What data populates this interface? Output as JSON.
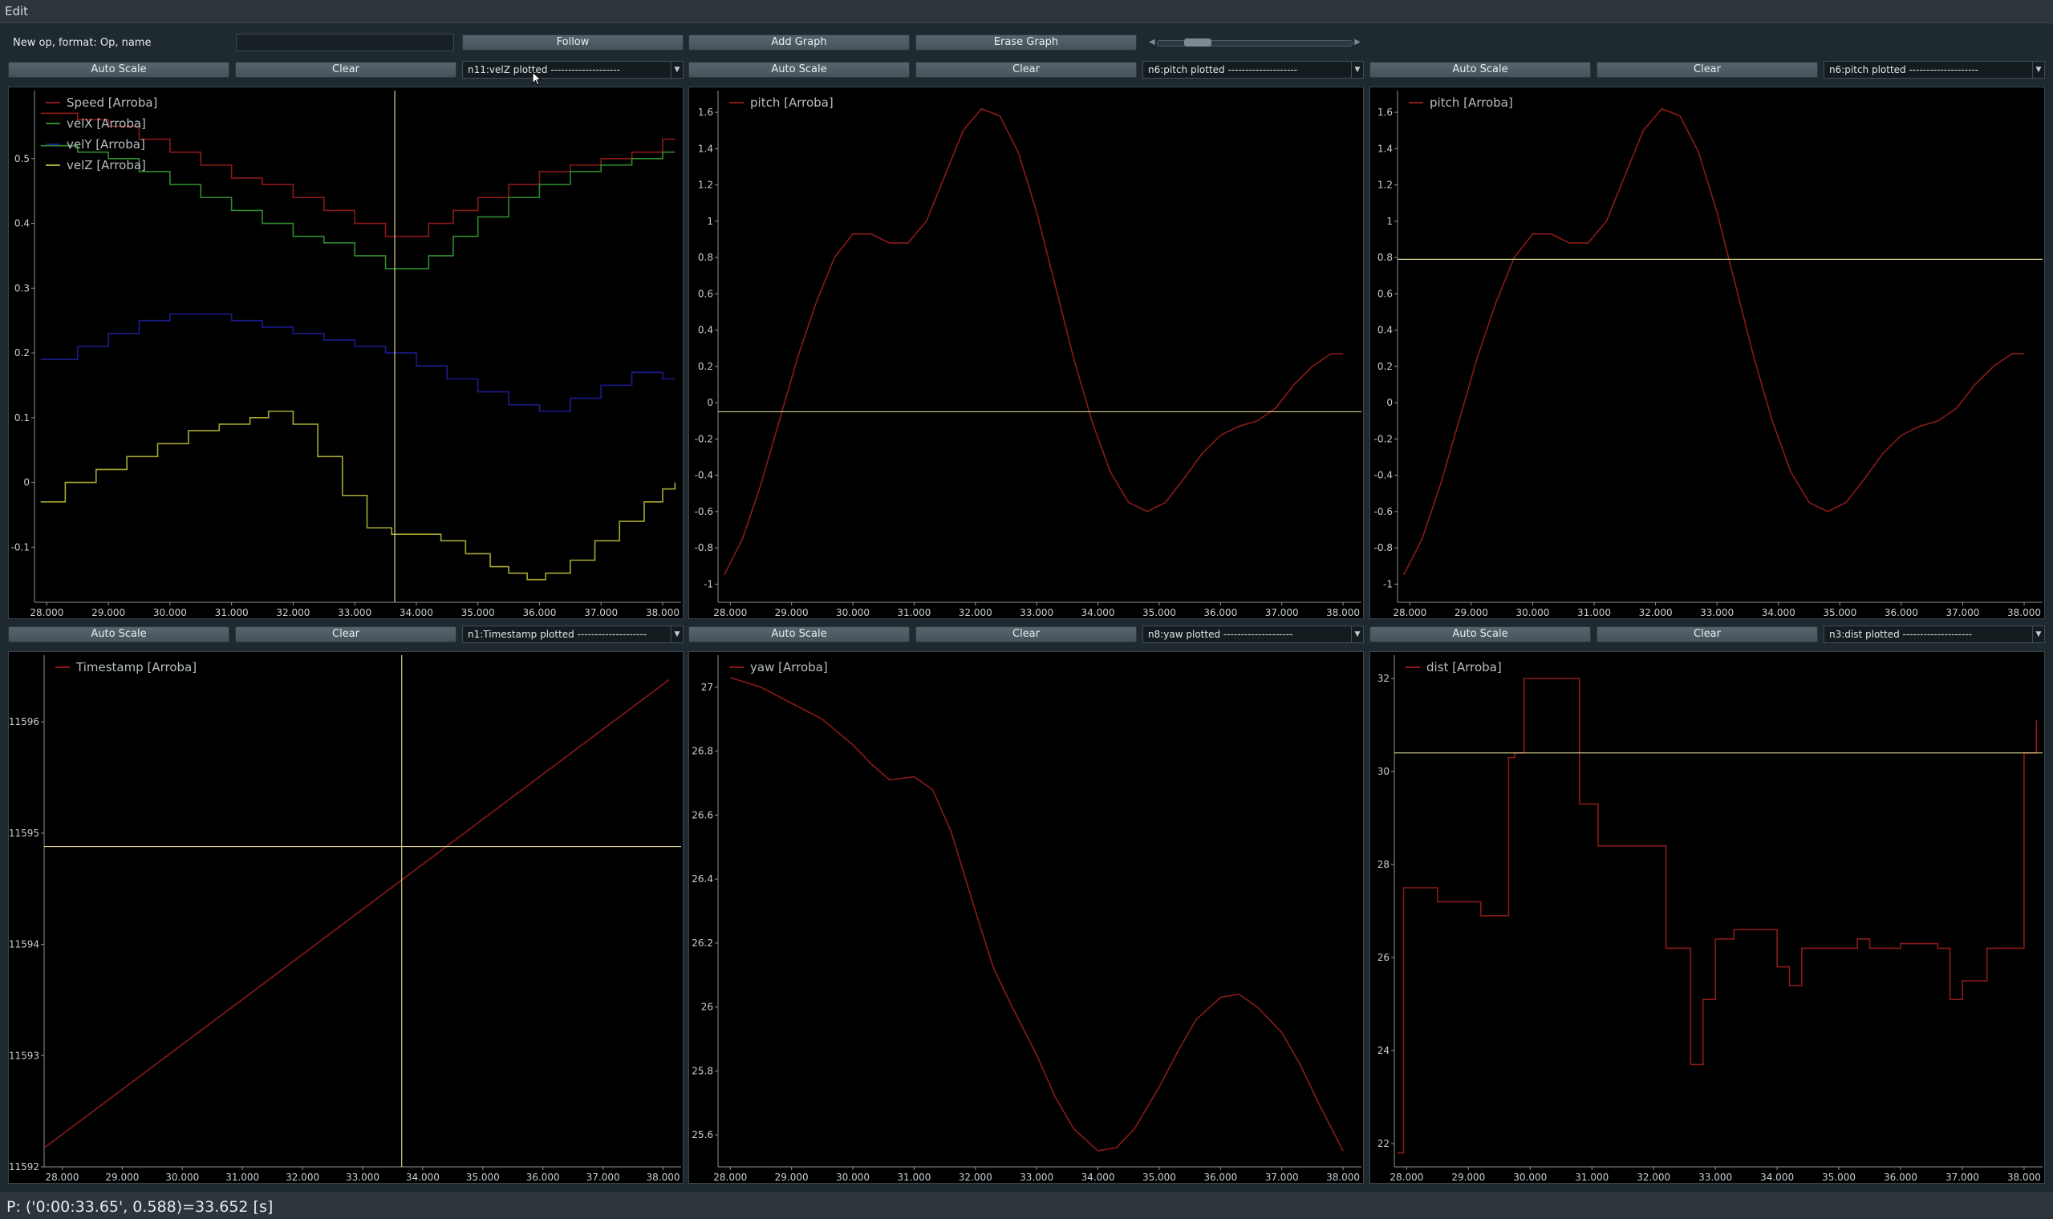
{
  "menubar": {
    "edit": "Edit"
  },
  "toolbar": {
    "new_op_label": "New op, format: Op, name",
    "new_op_value": "",
    "follow": "Follow",
    "add_graph": "Add Graph",
    "erase_graph": "Erase Graph"
  },
  "panels": [
    {
      "autoscale": "Auto Scale",
      "clear": "Clear",
      "selector": "n11:velZ plotted --------------------",
      "chart_data": {
        "type": "line",
        "xlim": [
          27.8,
          38.3
        ],
        "ylim": [
          -0.185,
          0.605
        ],
        "xticks": [
          "28.000",
          "29.000",
          "30.000",
          "31.000",
          "32.000",
          "33.000",
          "34.000",
          "35.000",
          "36.000",
          "37.000",
          "38.000"
        ],
        "yticks": [
          {
            "v": 0.5,
            "t": "0.5"
          },
          {
            "v": 0.4,
            "t": "0.4"
          },
          {
            "v": 0.3,
            "t": "0.3"
          },
          {
            "v": 0.2,
            "t": "0.2"
          },
          {
            "v": 0.1,
            "t": "0.1"
          },
          {
            "v": 0,
            "t": "0"
          },
          {
            "v": -0.1,
            "t": "-0.1"
          }
        ],
        "step": true,
        "cursor": {
          "x": 33.65
        },
        "series": [
          {
            "name": "Speed [Arroba]",
            "color": "#8b1a1a",
            "x": [
              27.9,
              28.5,
              29.0,
              29.5,
              30.0,
              30.5,
              31.0,
              31.5,
              32.0,
              32.5,
              33.0,
              33.5,
              33.8,
              34.2,
              34.6,
              35.0,
              35.5,
              36.0,
              36.5,
              37.0,
              37.5,
              38.0,
              38.2
            ],
            "y": [
              0.57,
              0.56,
              0.55,
              0.53,
              0.51,
              0.49,
              0.47,
              0.46,
              0.44,
              0.42,
              0.4,
              0.38,
              0.38,
              0.4,
              0.42,
              0.44,
              0.46,
              0.48,
              0.49,
              0.5,
              0.51,
              0.53,
              0.53
            ]
          },
          {
            "name": "velX [Arroba]",
            "color": "#2e8b2e",
            "x": [
              27.9,
              28.5,
              29.0,
              29.5,
              30.0,
              30.5,
              31.0,
              31.5,
              32.0,
              32.5,
              33.0,
              33.5,
              33.8,
              34.2,
              34.6,
              35.0,
              35.5,
              36.0,
              36.5,
              37.0,
              37.5,
              38.0,
              38.2
            ],
            "y": [
              0.52,
              0.51,
              0.5,
              0.48,
              0.46,
              0.44,
              0.42,
              0.4,
              0.38,
              0.37,
              0.35,
              0.33,
              0.33,
              0.35,
              0.38,
              0.41,
              0.44,
              0.46,
              0.48,
              0.49,
              0.5,
              0.51,
              0.51
            ]
          },
          {
            "name": "velY [Arroba]",
            "color": "#1c1c8f",
            "x": [
              27.9,
              28.5,
              29.0,
              29.5,
              30.0,
              30.5,
              31.0,
              31.5,
              32.0,
              32.5,
              33.0,
              33.5,
              34.0,
              34.5,
              35.0,
              35.5,
              36.0,
              36.5,
              37.0,
              37.5,
              38.0,
              38.2
            ],
            "y": [
              0.19,
              0.21,
              0.23,
              0.25,
              0.26,
              0.26,
              0.25,
              0.24,
              0.23,
              0.22,
              0.21,
              0.2,
              0.18,
              0.16,
              0.14,
              0.12,
              0.11,
              0.13,
              0.15,
              0.17,
              0.16,
              0.16
            ]
          },
          {
            "name": "velZ [Arroba]",
            "color": "#a8a832",
            "x": [
              27.9,
              28.3,
              28.8,
              29.3,
              29.8,
              30.3,
              30.8,
              31.3,
              31.6,
              32.0,
              32.4,
              32.8,
              33.2,
              33.6,
              34.0,
              34.4,
              34.8,
              35.2,
              35.5,
              35.8,
              36.1,
              36.5,
              36.9,
              37.3,
              37.7,
              38.0,
              38.2
            ],
            "y": [
              -0.03,
              0.0,
              0.02,
              0.04,
              0.06,
              0.08,
              0.09,
              0.1,
              0.11,
              0.09,
              0.04,
              -0.02,
              -0.07,
              -0.08,
              -0.08,
              -0.09,
              -0.11,
              -0.13,
              -0.14,
              -0.15,
              -0.14,
              -0.12,
              -0.09,
              -0.06,
              -0.03,
              -0.01,
              0.0
            ]
          }
        ]
      }
    },
    {
      "autoscale": "Auto Scale",
      "clear": "Clear",
      "selector": "n6:pitch plotted --------------------",
      "chart_data": {
        "type": "line",
        "xlim": [
          27.8,
          38.3
        ],
        "ylim": [
          -1.1,
          1.72
        ],
        "xticks": [
          "28.000",
          "29.000",
          "30.000",
          "31.000",
          "32.000",
          "33.000",
          "34.000",
          "35.000",
          "36.000",
          "37.000",
          "38.000"
        ],
        "yticks": [
          {
            "v": 1.6,
            "t": "1.6"
          },
          {
            "v": 1.4,
            "t": "1.4"
          },
          {
            "v": 1.2,
            "t": "1.2"
          },
          {
            "v": 1,
            "t": "1"
          },
          {
            "v": 0.8,
            "t": "0.8"
          },
          {
            "v": 0.6,
            "t": "0.6"
          },
          {
            "v": 0.4,
            "t": "0.4"
          },
          {
            "v": 0.2,
            "t": "0.2"
          },
          {
            "v": 0,
            "t": "0"
          },
          {
            "v": -0.2,
            "t": "-0.2"
          },
          {
            "v": -0.4,
            "t": "-0.4"
          },
          {
            "v": -0.6,
            "t": "-0.6"
          },
          {
            "v": -0.8,
            "t": "-0.8"
          },
          {
            "v": -1,
            "t": "-1"
          }
        ],
        "hline": -0.05,
        "series": [
          {
            "name": "pitch [Arroba]",
            "color": "#8b1a1a",
            "x": [
              27.9,
              28.2,
              28.5,
              28.8,
              29.1,
              29.4,
              29.7,
              30.0,
              30.3,
              30.6,
              30.9,
              31.2,
              31.5,
              31.8,
              32.1,
              32.4,
              32.7,
              33.0,
              33.3,
              33.6,
              33.9,
              34.2,
              34.5,
              34.8,
              35.1,
              35.4,
              35.7,
              36.0,
              36.3,
              36.6,
              36.9,
              37.2,
              37.5,
              37.8,
              38.0
            ],
            "y": [
              -0.95,
              -0.75,
              -0.45,
              -0.1,
              0.25,
              0.55,
              0.8,
              0.93,
              0.93,
              0.88,
              0.88,
              1.0,
              1.25,
              1.5,
              1.62,
              1.58,
              1.38,
              1.05,
              0.65,
              0.25,
              -0.1,
              -0.38,
              -0.55,
              -0.6,
              -0.55,
              -0.42,
              -0.28,
              -0.18,
              -0.13,
              -0.1,
              -0.03,
              0.1,
              0.2,
              0.27,
              0.27
            ]
          }
        ]
      }
    },
    {
      "autoscale": "Auto Scale",
      "clear": "Clear",
      "selector": "n6:pitch plotted --------------------",
      "chart_data": {
        "type": "line",
        "xlim": [
          27.8,
          38.3
        ],
        "ylim": [
          -1.1,
          1.72
        ],
        "xticks": [
          "28.000",
          "29.000",
          "30.000",
          "31.000",
          "32.000",
          "33.000",
          "34.000",
          "35.000",
          "36.000",
          "37.000",
          "38.000"
        ],
        "yticks": [
          {
            "v": 1.6,
            "t": "1.6"
          },
          {
            "v": 1.4,
            "t": "1.4"
          },
          {
            "v": 1.2,
            "t": "1.2"
          },
          {
            "v": 1,
            "t": "1"
          },
          {
            "v": 0.8,
            "t": "0.8"
          },
          {
            "v": 0.6,
            "t": "0.6"
          },
          {
            "v": 0.4,
            "t": "0.4"
          },
          {
            "v": 0.2,
            "t": "0.2"
          },
          {
            "v": 0,
            "t": "0"
          },
          {
            "v": -0.2,
            "t": "-0.2"
          },
          {
            "v": -0.4,
            "t": "-0.4"
          },
          {
            "v": -0.6,
            "t": "-0.6"
          },
          {
            "v": -0.8,
            "t": "-0.8"
          },
          {
            "v": -1,
            "t": "-1"
          }
        ],
        "hline": 0.79,
        "series": [
          {
            "name": "pitch [Arroba]",
            "color": "#8b1a1a",
            "x": [
              27.9,
              28.2,
              28.5,
              28.8,
              29.1,
              29.4,
              29.7,
              30.0,
              30.3,
              30.6,
              30.9,
              31.2,
              31.5,
              31.8,
              32.1,
              32.4,
              32.7,
              33.0,
              33.3,
              33.6,
              33.9,
              34.2,
              34.5,
              34.8,
              35.1,
              35.4,
              35.7,
              36.0,
              36.3,
              36.6,
              36.9,
              37.2,
              37.5,
              37.8,
              38.0
            ],
            "y": [
              -0.95,
              -0.75,
              -0.45,
              -0.1,
              0.25,
              0.55,
              0.8,
              0.93,
              0.93,
              0.88,
              0.88,
              1.0,
              1.25,
              1.5,
              1.62,
              1.58,
              1.38,
              1.05,
              0.65,
              0.25,
              -0.1,
              -0.38,
              -0.55,
              -0.6,
              -0.55,
              -0.42,
              -0.28,
              -0.18,
              -0.13,
              -0.1,
              -0.03,
              0.1,
              0.2,
              0.27,
              0.27
            ]
          }
        ]
      }
    },
    {
      "autoscale": "Auto Scale",
      "clear": "Clear",
      "selector": "n1:Timestamp plotted --------------------",
      "chart_data": {
        "type": "line",
        "xlim": [
          27.7,
          38.3
        ],
        "ylim": [
          11592.0,
          11596.6
        ],
        "xticks": [
          "28.000",
          "29.000",
          "30.000",
          "31.000",
          "32.000",
          "33.000",
          "34.000",
          "35.000",
          "36.000",
          "37.000",
          "38.000"
        ],
        "yticks": [
          {
            "v": 11596,
            "t": "11596"
          },
          {
            "v": 11595,
            "t": "11595"
          },
          {
            "v": 11594,
            "t": "11594"
          },
          {
            "v": 11593,
            "t": "11593"
          },
          {
            "v": 11592,
            "t": "11592"
          }
        ],
        "hline": 11594.88,
        "cursor": {
          "x": 33.65
        },
        "series": [
          {
            "name": "Timestamp [Arroba]",
            "color": "#8b1a1a",
            "x": [
              27.7,
              38.1
            ],
            "y": [
              11592.17,
              11596.38
            ]
          }
        ]
      }
    },
    {
      "autoscale": "Auto Scale",
      "clear": "Clear",
      "selector": "n8:yaw plotted --------------------",
      "chart_data": {
        "type": "line",
        "xlim": [
          27.8,
          38.3
        ],
        "ylim": [
          25.5,
          27.1
        ],
        "xticks": [
          "28.000",
          "29.000",
          "30.000",
          "31.000",
          "32.000",
          "33.000",
          "34.000",
          "35.000",
          "36.000",
          "37.000",
          "38.000"
        ],
        "yticks": [
          {
            "v": 27,
            "t": "27"
          },
          {
            "v": 26.8,
            "t": "26.8"
          },
          {
            "v": 26.6,
            "t": "26.6"
          },
          {
            "v": 26.4,
            "t": "26.4"
          },
          {
            "v": 26.2,
            "t": "26.2"
          },
          {
            "v": 26,
            "t": "26"
          },
          {
            "v": 25.8,
            "t": "25.8"
          },
          {
            "v": 25.6,
            "t": "25.6"
          }
        ],
        "series": [
          {
            "name": "yaw [Arroba]",
            "color": "#8b1a1a",
            "x": [
              28.0,
              28.5,
              29.0,
              29.5,
              30.0,
              30.3,
              30.6,
              31.0,
              31.3,
              31.6,
              32.0,
              32.3,
              32.6,
              33.0,
              33.3,
              33.6,
              34.0,
              34.3,
              34.6,
              35.0,
              35.3,
              35.6,
              36.0,
              36.3,
              36.6,
              37.0,
              37.3,
              37.6,
              38.0
            ],
            "y": [
              27.03,
              27.0,
              26.95,
              26.9,
              26.82,
              26.76,
              26.71,
              26.72,
              26.68,
              26.55,
              26.3,
              26.12,
              26.0,
              25.85,
              25.72,
              25.62,
              25.55,
              25.56,
              25.62,
              25.75,
              25.86,
              25.96,
              26.03,
              26.04,
              26.0,
              25.92,
              25.82,
              25.7,
              25.55
            ]
          }
        ]
      }
    },
    {
      "autoscale": "Auto Scale",
      "clear": "Clear",
      "selector": "n3:dist plotted --------------------",
      "chart_data": {
        "type": "line",
        "xlim": [
          27.8,
          38.3
        ],
        "ylim": [
          21.5,
          32.5
        ],
        "xticks": [
          "28.000",
          "29.000",
          "30.000",
          "31.000",
          "32.000",
          "33.000",
          "34.000",
          "35.000",
          "36.000",
          "37.000",
          "38.000"
        ],
        "yticks": [
          {
            "v": 32,
            "t": "32"
          },
          {
            "v": 30,
            "t": "30"
          },
          {
            "v": 28,
            "t": "28"
          },
          {
            "v": 26,
            "t": "26"
          },
          {
            "v": 24,
            "t": "24"
          },
          {
            "v": 22,
            "t": "22"
          }
        ],
        "step": true,
        "hline": 30.4,
        "series": [
          {
            "name": "dist [Arroba]",
            "color": "#8b1a1a",
            "x": [
              27.85,
              27.95,
              28.5,
              29.2,
              29.65,
              29.75,
              29.9,
              30.8,
              31.1,
              31.4,
              32.2,
              32.6,
              32.8,
              33.0,
              33.3,
              34.0,
              34.2,
              34.4,
              34.6,
              35.3,
              35.5,
              36.0,
              36.6,
              36.8,
              37.0,
              37.4,
              37.6,
              38.0,
              38.2
            ],
            "y": [
              21.8,
              27.5,
              27.2,
              26.9,
              30.3,
              30.4,
              32.0,
              29.3,
              28.4,
              28.4,
              26.2,
              23.7,
              25.1,
              26.4,
              26.6,
              25.8,
              25.4,
              26.2,
              26.2,
              26.4,
              26.2,
              26.3,
              26.2,
              25.1,
              25.5,
              26.2,
              26.2,
              30.4,
              31.1
            ]
          }
        ]
      }
    }
  ],
  "status": {
    "text": "P: ('0:00:33.65', 0.588)=33.652 [s]"
  }
}
